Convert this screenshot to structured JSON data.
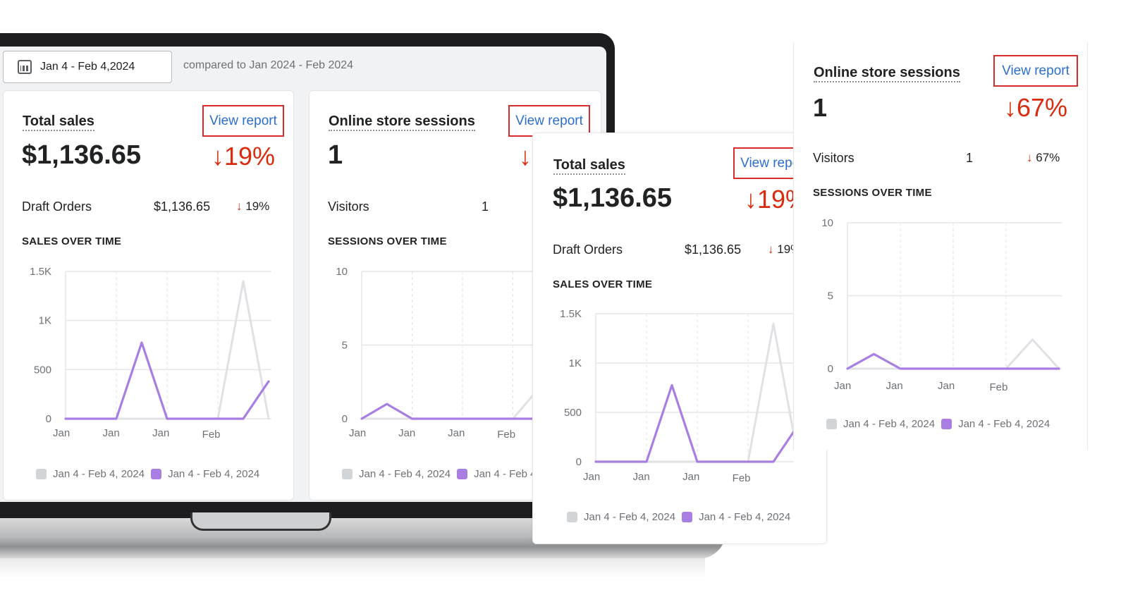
{
  "date_range": {
    "label": "Jan 4 - Feb 4,2024",
    "compared": "compared to Jan 2024 - Feb 2024"
  },
  "total_sales": {
    "title": "Total sales",
    "view_report": "View report",
    "value": "$1,136.65",
    "change": "19%",
    "row_label": "Draft Orders",
    "row_value": "$1,136.65",
    "row_change": "19%",
    "section": "SALES OVER TIME"
  },
  "sessions": {
    "title": "Online store sessions",
    "view_report": "View report",
    "value": "1",
    "change": "67%",
    "row_label": "Visitors",
    "row_value": "1",
    "row_change": "67%",
    "section": "SESSIONS OVER TIME"
  },
  "legend": {
    "previous": "Jan 4 - Feb 4, 2024",
    "current": "Jan 4 - Feb 4, 2024"
  },
  "arrow": "↓",
  "colors": {
    "current": "#a97ee3",
    "previous": "#dfe1e4",
    "decline": "#d72c0d",
    "link": "#2c6ecb",
    "highlight": "#d82c2c"
  },
  "chart_data": [
    {
      "type": "line",
      "section": "SALES OVER TIME",
      "y_ticks": [
        "0",
        "500",
        "1K",
        "1.5K"
      ],
      "ylim": [
        0,
        1500
      ],
      "x_ticks": [
        "Jan",
        "Jan",
        "Jan",
        "Feb"
      ],
      "grid": true,
      "series": [
        {
          "name": "Jan 4 - Feb 4, 2024",
          "color": "#dfe1e4",
          "values": [
            0,
            0,
            0,
            0,
            0,
            0,
            0,
            1400,
            0
          ]
        },
        {
          "name": "Jan 4 - Feb 4, 2024",
          "color": "#a97ee3",
          "values": [
            0,
            0,
            0,
            775,
            0,
            0,
            0,
            0,
            380
          ]
        }
      ]
    },
    {
      "type": "line",
      "section": "SESSIONS OVER TIME",
      "y_ticks": [
        "0",
        "5",
        "10"
      ],
      "ylim": [
        0,
        10
      ],
      "x_ticks": [
        "Jan",
        "Jan",
        "Jan",
        "Feb"
      ],
      "grid": true,
      "series": [
        {
          "name": "Jan 4 - Feb 4, 2024",
          "color": "#dfe1e4",
          "values": [
            0,
            0,
            0,
            0,
            0,
            0,
            0,
            2,
            0
          ]
        },
        {
          "name": "Jan 4 - Feb 4, 2024",
          "color": "#a97ee3",
          "values": [
            0,
            1,
            0,
            0,
            0,
            0,
            0,
            0,
            0
          ]
        }
      ]
    }
  ]
}
